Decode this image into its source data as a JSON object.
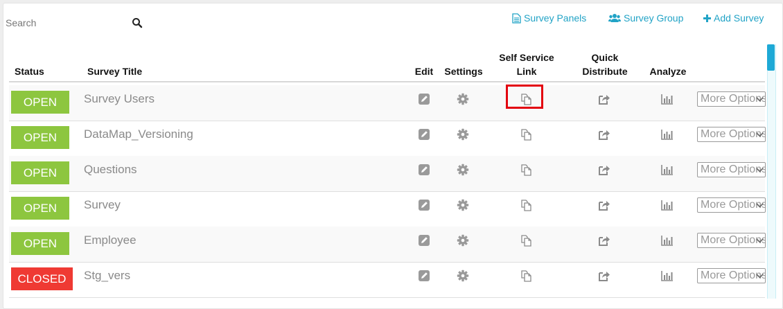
{
  "search": {
    "placeholder": "Search",
    "icon": "search-icon"
  },
  "toolbar": {
    "survey_panels": "Survey Panels",
    "survey_group": "Survey Group",
    "add_survey": "Add Survey"
  },
  "columns": {
    "status": "Status",
    "title": "Survey Title",
    "edit": "Edit",
    "settings": "Settings",
    "self_service_1": "Self Service",
    "self_service_2": "Link",
    "quick_1": "Quick",
    "quick_2": "Distribute",
    "analyze": "Analyze"
  },
  "rows": [
    {
      "status": "OPEN",
      "title": "Survey Users",
      "more": "More Options"
    },
    {
      "status": "OPEN",
      "title": "DataMap_Versioning",
      "more": "More Options"
    },
    {
      "status": "OPEN",
      "title": "Questions",
      "more": "More Options"
    },
    {
      "status": "OPEN",
      "title": "Survey",
      "more": "More Options"
    },
    {
      "status": "OPEN",
      "title": "Employee",
      "more": "More Options"
    },
    {
      "status": "CLOSED",
      "title": "Stg_vers",
      "more": "More Options"
    }
  ],
  "colors": {
    "accent": "#21a3c6",
    "open": "#8dc63f",
    "closed": "#ef3a33",
    "highlight": "#e3000f"
  }
}
